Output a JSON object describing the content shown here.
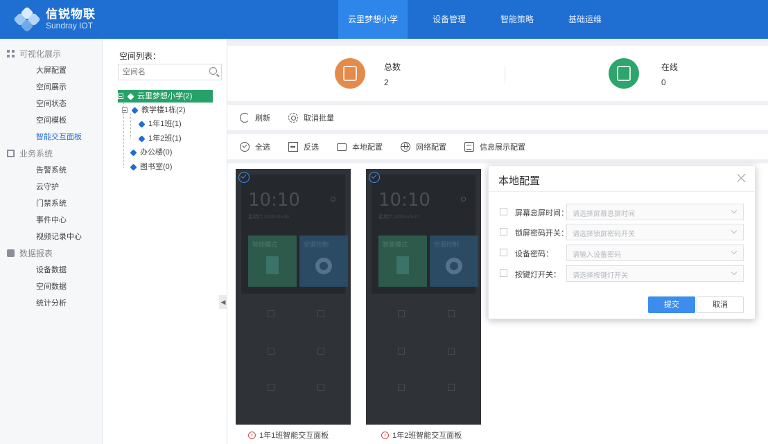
{
  "brand": {
    "name_cn": "信锐物联",
    "name_en": "Sundray IOT"
  },
  "nav": {
    "tabs": [
      {
        "label": "云里梦想小学"
      },
      {
        "label": "设备管理"
      },
      {
        "label": "智能策略"
      },
      {
        "label": "基础运维"
      }
    ]
  },
  "sidebar": {
    "groups": [
      {
        "label": "可视化展示",
        "icon": "grid-icon",
        "items": [
          "大屏配置",
          "空间展示",
          "空间状态",
          "空间模板",
          "智能交互面板"
        ]
      },
      {
        "label": "业务系统",
        "icon": "business-icon",
        "items": [
          "告警系统",
          "云守护",
          "门禁系统",
          "事件中心",
          "视频记录中心"
        ]
      },
      {
        "label": "数据报表",
        "icon": "report-icon",
        "items": [
          "设备数据",
          "空间数据",
          "统计分析"
        ]
      }
    ],
    "active_item": "智能交互面板"
  },
  "tree": {
    "title": "空间列表：",
    "search_placeholder": "空间名",
    "nodes": [
      "云里梦想小学(2)",
      "教学楼1栋(2)",
      "1年1班(1)",
      "1年2班(1)",
      "办公楼(0)",
      "图书室(0)"
    ]
  },
  "stats": {
    "total_label": "总数",
    "total_value": "2",
    "online_label": "在线",
    "online_value": "0"
  },
  "toolbar1": {
    "refresh": "刷新",
    "cancel_batch": "取消批量"
  },
  "toolbar2": {
    "select_all": "全选",
    "invert": "反选",
    "local_config": "本地配置",
    "network_config": "网络配置",
    "info_display": "信息展示配置"
  },
  "devices": [
    {
      "time": "10:10",
      "date": "星期六 2020-10-10",
      "caption": "1年1班智能交互面板",
      "tile1": "智能模式",
      "tile2": "空调控制"
    },
    {
      "time": "10:10",
      "date": "星期六 2020-10-10",
      "caption": "1年2班智能交互面板",
      "tile1": "智能模式",
      "tile2": "空调控制"
    }
  ],
  "modal": {
    "title": "本地配置",
    "fields": [
      {
        "label": "屏幕息屏时间：",
        "placeholder": "请选择屏幕息屏时间"
      },
      {
        "label": "锁屏密码开关：",
        "placeholder": "请选择锁屏密码开关"
      },
      {
        "label": "设备密码：",
        "placeholder": "请输入设备密码"
      },
      {
        "label": "按键灯开关：",
        "placeholder": "请选择按键灯开关"
      }
    ],
    "submit": "提交",
    "cancel": "取消"
  },
  "colors": {
    "primary": "#1e6fd1",
    "green": "#27a168",
    "orange": "#e48a4a",
    "warning": "#e24848"
  }
}
